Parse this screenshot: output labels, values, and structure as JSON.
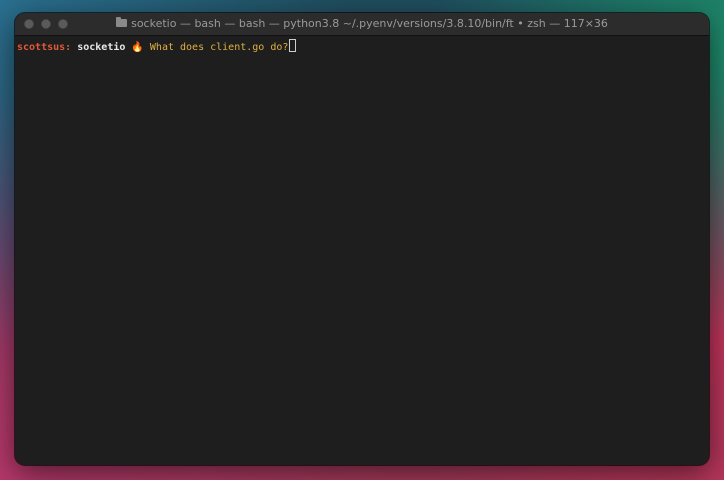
{
  "window": {
    "title": "socketio — bash — bash — python3.8 ~/.pyenv/versions/3.8.10/bin/ft • zsh — 117×36"
  },
  "terminal": {
    "prompt_user": "scottsus:",
    "prompt_dir": "socketio",
    "prompt_symbol": "🔥",
    "command": "What does client.go do?"
  }
}
